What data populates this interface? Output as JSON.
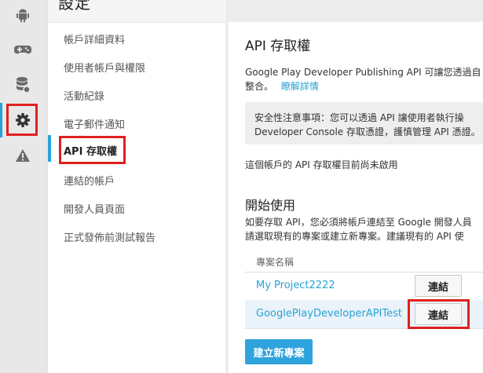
{
  "sidebar_icons": [
    {
      "name": "android-icon"
    },
    {
      "name": "gamepad-icon"
    },
    {
      "name": "database-icon"
    },
    {
      "name": "gear-icon"
    },
    {
      "name": "warning-icon"
    }
  ],
  "settings": {
    "title": "設定",
    "nav": [
      {
        "label": "帳戶詳細資料"
      },
      {
        "label": "使用者帳戶與權限"
      },
      {
        "label": "活動紀錄"
      },
      {
        "label": "電子郵件通知"
      },
      {
        "label": "API 存取權"
      },
      {
        "label": "連結的帳戶"
      },
      {
        "label": "開發人員頁面"
      },
      {
        "label": "正式發佈前測試報告"
      }
    ]
  },
  "main": {
    "title": "API 存取權",
    "intro_line1": "Google Play Developer Publishing API 可讓您透過自",
    "intro_line2": "整合。",
    "learn_more": "瞭解詳情",
    "notice_line1": "安全性注意事項：您可以透過 API 讓使用者執行操",
    "notice_line2": "Developer Console 存取憑證，護慎管理 API 憑證。",
    "status_text": "這個帳戶的 API 存取權目前尚未啟用",
    "get_started_title": "開始使用",
    "get_started_line1": "如要存取 API，您必須將帳戶連結至 Google 開發人員",
    "get_started_line2": "請選取現有的專案或建立新專案。建議現有的 API 使",
    "table_header": "專案名稱",
    "projects": [
      {
        "name": "My Project2222",
        "button": "連結"
      },
      {
        "name": "GooglePlayDeveloperAPITest",
        "button": "連結"
      }
    ],
    "create_button": "建立新專案"
  },
  "colors": {
    "accent": "#27a3d6",
    "highlight": "#e02020",
    "primary_button": "#2ea3dc"
  }
}
